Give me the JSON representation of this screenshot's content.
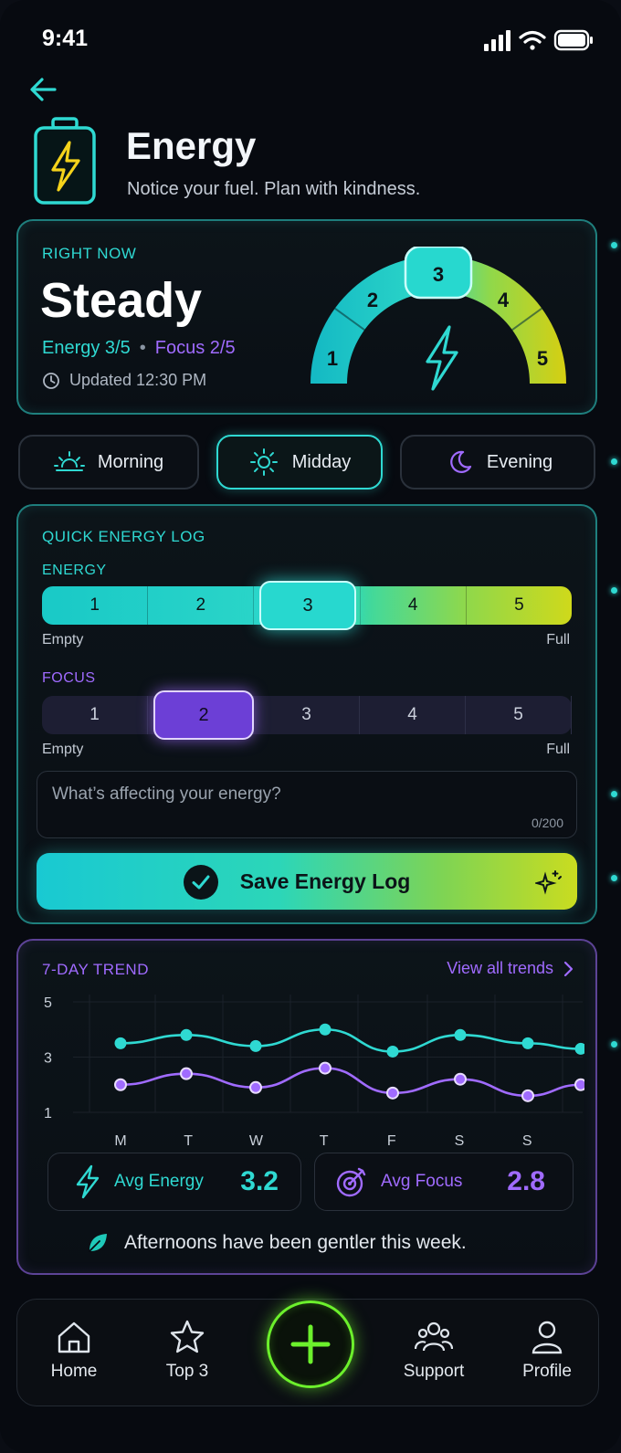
{
  "status_bar": {
    "time": "9:41"
  },
  "header": {
    "title": "Energy",
    "subtitle": "Notice your fuel. Plan with kindness."
  },
  "right_now": {
    "label": "RIGHT NOW",
    "state": "Steady",
    "energy_text": "Energy 3/5",
    "focus_text": "Focus 2/5",
    "updated": "Updated 12:30 PM",
    "gauge_levels": [
      "1",
      "2",
      "3",
      "4",
      "5"
    ],
    "gauge_selected": 3
  },
  "time_of_day": {
    "options": [
      {
        "label": "Morning"
      },
      {
        "label": "Midday"
      },
      {
        "label": "Evening"
      }
    ],
    "selected": "Midday"
  },
  "quick_log": {
    "title": "QUICK ENERGY LOG",
    "energy_label": "ENERGY",
    "focus_label": "FOCUS",
    "levels": [
      "1",
      "2",
      "3",
      "4",
      "5"
    ],
    "energy_selected": 3,
    "focus_selected": 2,
    "min_label": "Empty",
    "max_label": "Full",
    "note_placeholder": "What’s affecting your energy?",
    "note_count": "0/200",
    "save_label": "Save Energy Log"
  },
  "trend": {
    "title": "7-DAY TREND",
    "view_all": "View all trends",
    "avg_energy_label": "Avg Energy",
    "avg_energy_value": "3.2",
    "avg_focus_label": "Avg Focus",
    "avg_focus_value": "2.8",
    "insight": "Afternoons have been gentler this week."
  },
  "chart_data": {
    "type": "line",
    "categories": [
      "M",
      "T",
      "W",
      "T",
      "F",
      "S",
      "S"
    ],
    "y_ticks": [
      "5",
      "3",
      "1"
    ],
    "ylim": [
      1,
      5
    ],
    "grid": true,
    "series": [
      {
        "values": [
          3.5,
          3.8,
          3.4,
          4.0,
          3.2,
          3.8,
          3.5,
          3.3
        ],
        "color": "#2fd9d2"
      },
      {
        "values": [
          2.0,
          2.4,
          1.9,
          2.6,
          1.7,
          2.2,
          1.6,
          2.0
        ],
        "color": "#a06bff"
      }
    ]
  },
  "nav": {
    "items": [
      {
        "label": "Home"
      },
      {
        "label": "Top 3"
      },
      {
        "label": "Support"
      },
      {
        "label": "Profile"
      }
    ]
  },
  "colors": {
    "teal": "#2fd9d2",
    "violet": "#a06bff",
    "lime": "#6cf02c",
    "background": "#070a10"
  }
}
